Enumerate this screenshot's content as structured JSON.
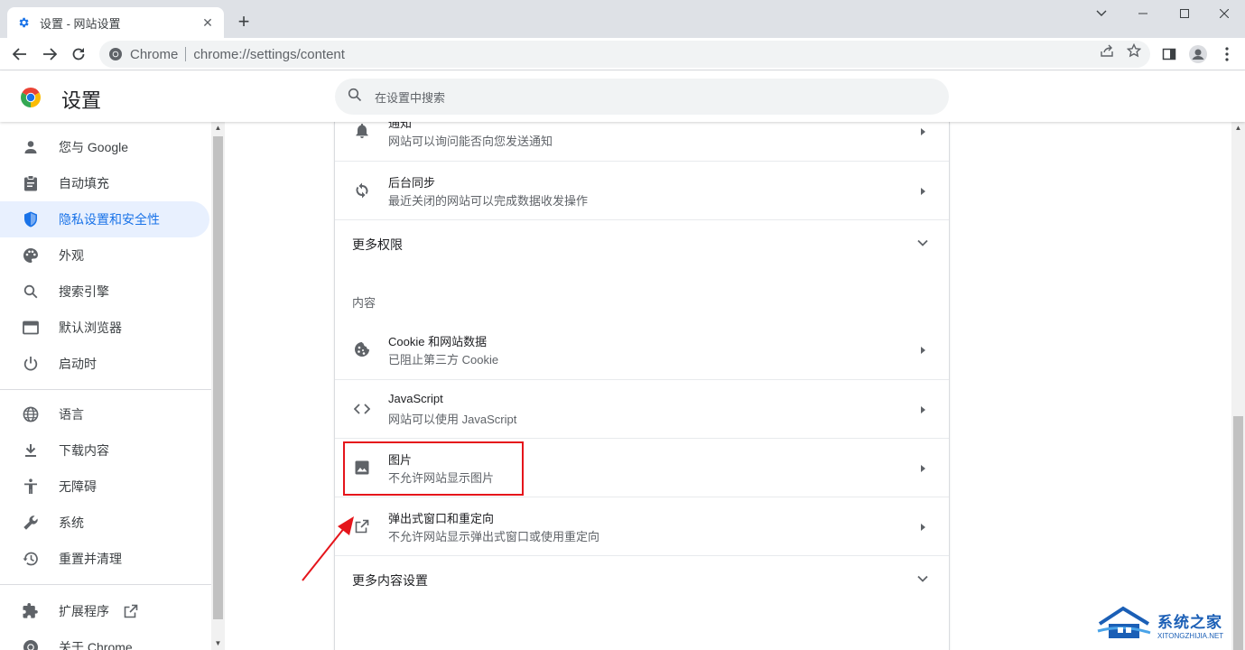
{
  "browser": {
    "tab_title": "设置 - 网站设置",
    "new_tab": "+",
    "window_controls": [
      "minimize",
      "maximize",
      "close"
    ],
    "omnibox": {
      "site_chip": "Chrome",
      "url": "chrome://settings/content"
    }
  },
  "settings_header": {
    "title": "设置",
    "search_placeholder": "在设置中搜索"
  },
  "sidebar": {
    "items": [
      {
        "label": "您与 Google",
        "icon": "person-icon"
      },
      {
        "label": "自动填充",
        "icon": "clipboard-icon"
      },
      {
        "label": "隐私设置和安全性",
        "icon": "shield-icon",
        "active": true
      },
      {
        "label": "外观",
        "icon": "palette-icon"
      },
      {
        "label": "搜索引擎",
        "icon": "search-icon"
      },
      {
        "label": "默认浏览器",
        "icon": "browser-icon"
      },
      {
        "label": "启动时",
        "icon": "power-icon"
      },
      {
        "label": "语言",
        "icon": "globe-icon"
      },
      {
        "label": "下载内容",
        "icon": "download-icon"
      },
      {
        "label": "无障碍",
        "icon": "accessibility-icon"
      },
      {
        "label": "系统",
        "icon": "wrench-icon"
      },
      {
        "label": "重置并清理",
        "icon": "history-icon"
      },
      {
        "label": "扩展程序",
        "icon": "puzzle-icon"
      },
      {
        "label": "关于 Chrome",
        "icon": "chrome-icon"
      }
    ]
  },
  "content": {
    "rows_top": [
      {
        "title": "通知",
        "subtitle": "网站可以询问能否向您发送通知",
        "icon": "bell-icon"
      },
      {
        "title": "后台同步",
        "subtitle": "最近关闭的网站可以完成数据收发操作",
        "icon": "sync-icon"
      }
    ],
    "more_permissions": "更多权限",
    "section_heading": "内容",
    "rows_content": [
      {
        "title": "Cookie 和网站数据",
        "subtitle": "已阻止第三方 Cookie",
        "icon": "cookie-icon"
      },
      {
        "title": "JavaScript",
        "subtitle": "网站可以使用 JavaScript",
        "icon": "code-icon"
      },
      {
        "title": "图片",
        "subtitle": "不允许网站显示图片",
        "icon": "image-icon"
      },
      {
        "title": "弹出式窗口和重定向",
        "subtitle": "不允许网站显示弹出式窗口或使用重定向",
        "icon": "open-external-icon"
      }
    ],
    "more_content_settings": "更多内容设置"
  },
  "annotations": {
    "highlight_color": "#e5151b",
    "arrow_color": "#e5151b"
  },
  "watermark": {
    "cn": "系统之家",
    "en": "XITONGZHIJIA.NET"
  },
  "colors": {
    "accent": "#1a73e8",
    "active_nav_bg": "#e8f0fe",
    "tab_strip": "#dee1e6"
  }
}
